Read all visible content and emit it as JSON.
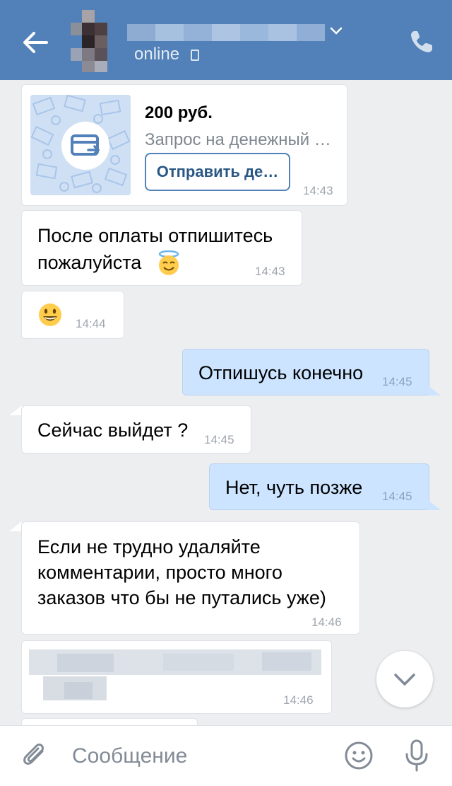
{
  "header": {
    "status": "online"
  },
  "messages": {
    "m0": {
      "amount": "200 руб.",
      "subtitle": "Запрос на денежный …",
      "button": "Отправить де…",
      "time": "14:43"
    },
    "m1": {
      "line1": "После оплаты отпишитесь",
      "line2": "пожалуйста",
      "emoji": "smiling-face-with-halo-icon",
      "time": "14:43"
    },
    "m2": {
      "emoji": "grinning-face-icon",
      "time": "14:44"
    },
    "m3": {
      "text": "Отпишусь конечно",
      "time": "14:45"
    },
    "m4": {
      "text": "Сейчас выйдет ?",
      "time": "14:45"
    },
    "m5": {
      "text": "Нет, чуть позже",
      "time": "14:45"
    },
    "m6": {
      "line1": "Если не трудно удаляйте",
      "line2": "комментарии, просто много",
      "line3": "заказов что бы не путались уже)",
      "time": "14:46"
    },
    "m7": {
      "time": "14:46"
    }
  },
  "composer": {
    "placeholder": "Сообщение"
  },
  "colors": {
    "header": "#5181b8",
    "background": "#edeef0",
    "incoming_bubble": "#ffffff",
    "outgoing_bubble": "#cce4ff",
    "accent": "#5181b8"
  }
}
